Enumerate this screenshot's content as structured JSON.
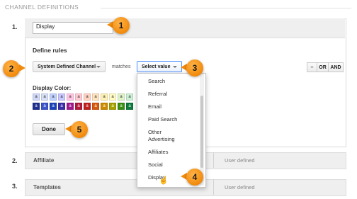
{
  "section": {
    "title": "CHANNEL DEFINITIONS"
  },
  "channel1": {
    "number": "1.",
    "name_value": "Display",
    "define_rules_label": "Define rules",
    "rule": {
      "dimension": "System Defined Channel",
      "operator": "matches",
      "value_placeholder": "Select value"
    },
    "logic_buttons": [
      "–",
      "OR",
      "AND"
    ],
    "display_color_label": "Display Color:",
    "done_label": "Done"
  },
  "menu": {
    "items": [
      "Search",
      "Referral",
      "Email",
      "Paid Search",
      "Other",
      "Advertising",
      "Affiliates",
      "Social",
      "Display"
    ]
  },
  "rows": [
    {
      "number": "2.",
      "name": "Affiliate",
      "type": "User defined"
    },
    {
      "number": "3.",
      "name": "Templates",
      "type": "User defined"
    }
  ],
  "callouts": [
    "1",
    "2",
    "3",
    "4",
    "5"
  ],
  "swatch_letter": "a",
  "swatches_row1": [
    "#cfd8f7",
    "#d7def5",
    "#bfd0ff",
    "#c9c7ff",
    "#ffc4e2",
    "#ffc9d3",
    "#ffd2c2",
    "#ffe3bf",
    "#fff0b6",
    "#fffbc2",
    "#dff3c8",
    "#cdefd4"
  ],
  "swatches_row2": [
    "#1f2f8f",
    "#3d56c9",
    "#1c43b8",
    "#3b2ea8",
    "#a1198e",
    "#b21b3d",
    "#c02020",
    "#d55a11",
    "#cc8a00",
    "#a6a100",
    "#3a8f12",
    "#0d7c3d"
  ],
  "icons": {
    "cursor": "hand-pointer-icon",
    "caret": "caret-down-icon"
  },
  "colors": {
    "accent": "#4d90fe",
    "callout": "#f18a0c"
  }
}
